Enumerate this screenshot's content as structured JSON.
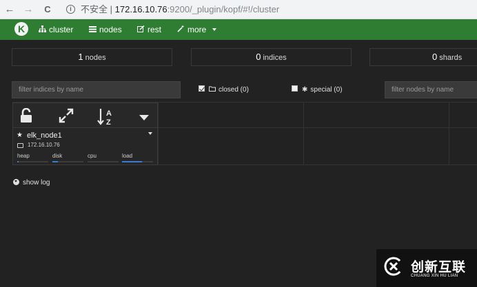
{
  "browser": {
    "back": "←",
    "forward": "→",
    "reload": "C",
    "security_label": "不安全",
    "separator": "|",
    "url_host": "172.16.10.76",
    "url_rest": ":9200/_plugin/kopf/#!/cluster"
  },
  "navbar": {
    "logo_letter": "K",
    "items": [
      {
        "label": "cluster",
        "icon": "sitemap-icon"
      },
      {
        "label": "nodes",
        "icon": "list-icon"
      },
      {
        "label": "rest",
        "icon": "edit-icon"
      },
      {
        "label": "more",
        "icon": "magic-icon"
      }
    ],
    "color": "#2e7d32"
  },
  "stats": {
    "nodes": {
      "value": "1",
      "label": "nodes"
    },
    "indices": {
      "value": "0",
      "label": "indices"
    },
    "shards": {
      "value": "0",
      "label": "shards"
    }
  },
  "filters": {
    "indices_placeholder": "filter indices by name",
    "nodes_placeholder": "filter nodes by name",
    "closed_label": "closed (0)",
    "closed_checked": true,
    "special_label": "special (0)",
    "special_checked": false
  },
  "toolbar": {
    "icons": [
      "unlock-icon",
      "expand-icon",
      "sort-alpha-icon",
      "caret-down-icon"
    ]
  },
  "node": {
    "name": "elk_node1",
    "ip": "172.16.10.76",
    "metrics": [
      {
        "label": "heap",
        "fraction": 0.04
      },
      {
        "label": "disk",
        "fraction": 0.18
      },
      {
        "label": "cpu",
        "fraction": 0.0
      },
      {
        "label": "load",
        "fraction": 0.65
      }
    ]
  },
  "log": {
    "label": "show log"
  },
  "watermark": {
    "cn": "创新互联",
    "en": "CHUANG XIN HU LIAN"
  }
}
